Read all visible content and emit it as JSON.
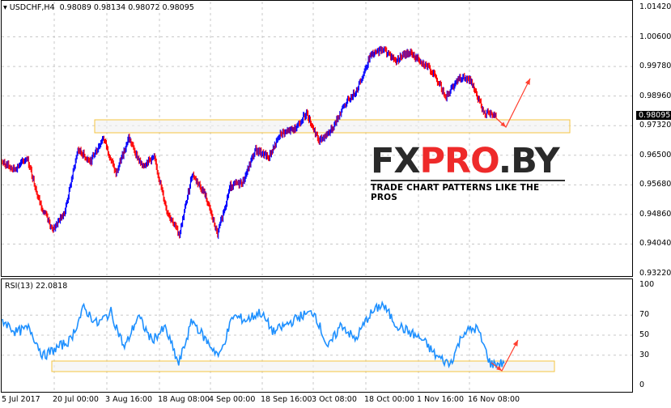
{
  "header": {
    "symbol": "USDCHF,H4",
    "ohlc": "0.98089 0.98134 0.98072 0.98095"
  },
  "rsi_label": "RSI(13) 22.0818",
  "price_axis": [
    "1.01420",
    "1.00600",
    "0.99780",
    "0.98960",
    "0.97320",
    "0.96500",
    "0.95680",
    "0.94860",
    "0.94040",
    "0.93220"
  ],
  "current_price": "0.98095",
  "rsi_axis": [
    "100",
    "70",
    "50",
    "30",
    "0"
  ],
  "time_axis": [
    "5 Jul 2017",
    "20 Jul 00:00",
    "3 Aug 16:00",
    "18 Aug 08:00",
    "4 Sep 00:00",
    "18 Sep 16:00",
    "3 Oct 08:00",
    "18 Oct 00:00",
    "1 Nov 16:00",
    "16 Nov 08:00"
  ],
  "logo": {
    "part1": "FX",
    "part2": "PRO",
    "part3": ".BY",
    "tagline": "TRADE CHART PATTERNS LIKE THE PROS"
  },
  "colors": {
    "up": "#0000ff",
    "down": "#ff0000",
    "rsi": "#1e90ff",
    "zone": "#f5c542",
    "arrow": "#ff4030"
  },
  "chart_data": {
    "type": "line",
    "price_keypoints": [
      0.9666,
      0.9642,
      0.9679,
      0.9542,
      0.9455,
      0.9517,
      0.9704,
      0.9666,
      0.9741,
      0.9629,
      0.9741,
      0.9654,
      0.9679,
      0.9517,
      0.9442,
      0.9629,
      0.9567,
      0.9442,
      0.9592,
      0.9604,
      0.9704,
      0.9679,
      0.9754,
      0.9766,
      0.9816,
      0.9729,
      0.9766,
      0.9841,
      0.9891,
      0.999,
      1.0015,
      0.9978,
      1.0003,
      0.9978,
      0.994,
      0.9866,
      0.9928,
      0.9915,
      0.9816,
      0.98095
    ],
    "rsi_keypoints": [
      65,
      53,
      57,
      29,
      37,
      45,
      77,
      61,
      73,
      37,
      69,
      45,
      57,
      21,
      65,
      45,
      29,
      69,
      65,
      73,
      53,
      61,
      69,
      73,
      37,
      61,
      45,
      69,
      81,
      61,
      53,
      45,
      29,
      21,
      53,
      57,
      21,
      22
    ],
    "price_range": [
      0.9322,
      1.0142
    ],
    "rsi_range": [
      0,
      100
    ]
  }
}
